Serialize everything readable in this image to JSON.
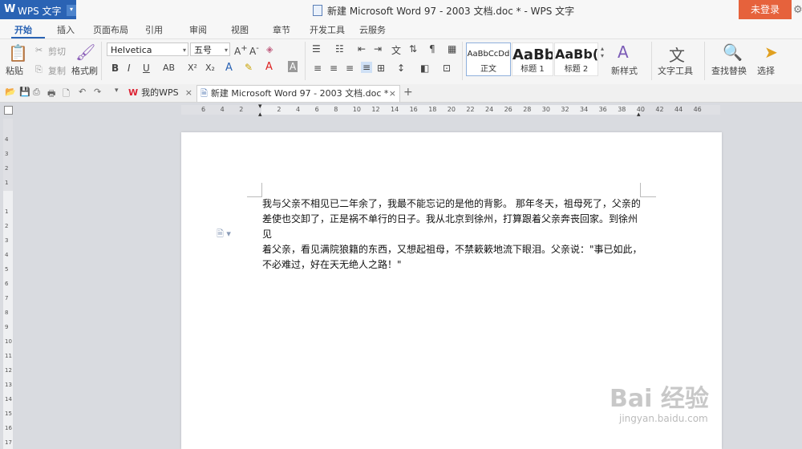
{
  "app": {
    "menu_icon": "W",
    "menu_label": "WPS 文字",
    "caret": "▾"
  },
  "title": {
    "text": "新建 Microsoft Word 97 - 2003 文档.doc * - WPS 文字"
  },
  "login_button": "未登录",
  "tabs": [
    "开始",
    "插入",
    "页面布局",
    "引用",
    "审阅",
    "视图",
    "章节",
    "开发工具",
    "云服务"
  ],
  "clipboard": {
    "paste": "粘贴",
    "cut": "剪切",
    "copy": "复制",
    "format_painter": "格式刷"
  },
  "font": {
    "name": "Helvetica",
    "size": "五号"
  },
  "styles": [
    {
      "preview": "AaBbCcDd",
      "name": "正文"
    },
    {
      "preview": "AaBb",
      "name": "标题 1"
    },
    {
      "preview": "AaBb(",
      "name": "标题 2"
    }
  ],
  "ribbon_right": {
    "new_style": "新样式",
    "text_tools": "文字工具",
    "find_replace": "查找替换",
    "select": "选择"
  },
  "doc_tabs": [
    {
      "label": "我的WPS",
      "close": "×"
    },
    {
      "label": "新建 Microsoft Word 97 - 2003 文档.doc *",
      "close": "×"
    }
  ],
  "add_tab": "+",
  "ruler_h": [
    "6",
    "4",
    "2",
    "",
    "2",
    "4",
    "6",
    "8",
    "10",
    "12",
    "14",
    "16",
    "18",
    "20",
    "22",
    "24",
    "26",
    "28",
    "30",
    "32",
    "34",
    "36",
    "38",
    "40",
    "42",
    "44",
    "46"
  ],
  "ruler_v": [
    "4",
    "3",
    "2",
    "1",
    "",
    "1",
    "2",
    "3",
    "4",
    "5",
    "6",
    "7",
    "8",
    "9",
    "10",
    "11",
    "12",
    "13",
    "14",
    "15",
    "16",
    "17"
  ],
  "document": {
    "lines": [
      "我与父亲不相见已二年余了，我最不能忘记的是他的背影。 那年冬天，祖母死了，父亲的",
      "差使也交卸了，正是祸不单行的日子。我从北京到徐州，打算跟着父亲奔丧回家。到徐州见",
      "着父亲，看见满院狼籍的东西，又想起祖母，不禁簌簌地流下眼泪。父亲说：\"事已如此，",
      "不必难过，好在天无绝人之路！\""
    ]
  },
  "watermark": {
    "main": "Bai 经验",
    "sub": "jingyan.baidu.com"
  }
}
